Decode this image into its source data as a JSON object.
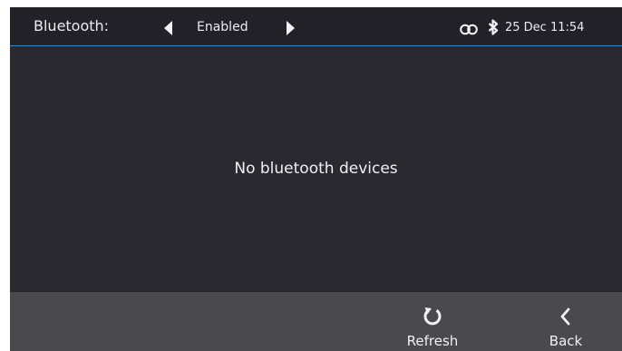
{
  "statusbar": {
    "title": "Bluetooth:",
    "value": "Enabled",
    "prev_icon": "triangle-left-icon",
    "next_icon": "triangle-right-icon",
    "voicemail_icon": "voicemail-icon",
    "bluetooth_icon": "bluetooth-icon",
    "datetime": "25 Dec 11:54",
    "accent_color": "#3a8bc4"
  },
  "main": {
    "empty_message": "No bluetooth devices"
  },
  "softkeys": [
    {
      "label": "Refresh",
      "icon": "refresh-icon"
    },
    {
      "label": "Back",
      "icon": "chevron-left-icon"
    }
  ]
}
